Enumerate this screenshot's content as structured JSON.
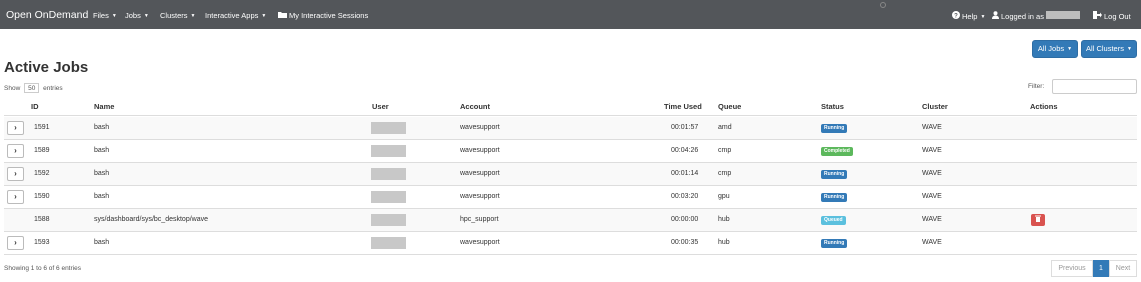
{
  "navbar": {
    "brand": "Open OnDemand",
    "items": [
      "Files",
      "Jobs",
      "Clusters",
      "Interactive Apps",
      "My Interactive Sessions"
    ],
    "help": "Help",
    "logged_in": "Logged in as",
    "logout": "Log Out"
  },
  "filters": {
    "jobs": "All Jobs",
    "clusters": "All Clusters"
  },
  "page": {
    "title": "Active Jobs"
  },
  "table_controls": {
    "show_prefix": "Show",
    "entries_value": "50",
    "show_suffix": "entries",
    "filter_label": "Filter:",
    "filter_value": ""
  },
  "table": {
    "headers": [
      "ID",
      "Name",
      "User",
      "Account",
      "Time Used",
      "Queue",
      "Status",
      "Cluster",
      "Actions"
    ],
    "rows": [
      {
        "id": "1591",
        "name": "bash",
        "account": "wavesupport",
        "time": "00:01:57",
        "queue": "amd",
        "status": "Running",
        "cluster": "WAVE"
      },
      {
        "id": "1589",
        "name": "bash",
        "account": "wavesupport",
        "time": "00:04:26",
        "queue": "cmp",
        "status": "Completed",
        "cluster": "WAVE"
      },
      {
        "id": "1592",
        "name": "bash",
        "account": "wavesupport",
        "time": "00:01:14",
        "queue": "cmp",
        "status": "Running",
        "cluster": "WAVE"
      },
      {
        "id": "1590",
        "name": "bash",
        "account": "wavesupport",
        "time": "00:03:20",
        "queue": "gpu",
        "status": "Running",
        "cluster": "WAVE"
      },
      {
        "id": "1588",
        "name": "sys/dashboard/sys/bc_desktop/wave",
        "account": "hpc_support",
        "time": "00:00:00",
        "queue": "hub",
        "status": "Queued",
        "cluster": "WAVE"
      },
      {
        "id": "1593",
        "name": "bash",
        "account": "wavesupport",
        "time": "00:00:35",
        "queue": "hub",
        "status": "Running",
        "cluster": "WAVE"
      }
    ]
  },
  "status_colors": {
    "running": "#337ab7",
    "completed": "#5cb85c",
    "queued": "#5bc0de"
  },
  "footer": {
    "showing": "Showing 1 to 6 of 6 entries"
  },
  "pagination": {
    "previous": "Previous",
    "current": "1",
    "next": "Next"
  },
  "icons": {
    "help": "question-circle-icon",
    "user": "user-icon",
    "logout": "sign-out-icon",
    "sessions": "folder-icon",
    "expand": "chevron-right-icon",
    "delete": "trash-icon"
  }
}
